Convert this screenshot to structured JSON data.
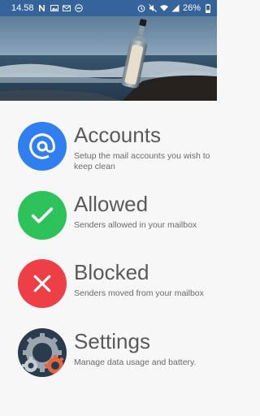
{
  "status_bar": {
    "time": "14.58",
    "left_icons": [
      "n-notification-icon",
      "image-notification-icon",
      "email-notification-icon",
      "minus-circle-icon"
    ],
    "right_icons": [
      "alarm-icon",
      "mute-icon",
      "wifi-icon",
      "signal-icon"
    ],
    "battery_percent": "26%"
  },
  "header": {
    "image": "bottle-on-beach-image"
  },
  "menu": {
    "items": [
      {
        "title": "Accounts",
        "subtitle": "Setup the mail accounts you wish to keep clean",
        "icon": "at-sign-icon",
        "color": "#2f7ff0"
      },
      {
        "title": "Allowed",
        "subtitle": "Senders allowed in your mailbox",
        "icon": "checkmark-icon",
        "color": "#2ec25a"
      },
      {
        "title": "Blocked",
        "subtitle": "Senders moved from your mailbox",
        "icon": "cross-icon",
        "color": "#ee3e46"
      },
      {
        "title": "Settings",
        "subtitle": "Manage data usage and battery.",
        "icon": "gears-icon",
        "color": "#2a3b4e"
      }
    ]
  }
}
